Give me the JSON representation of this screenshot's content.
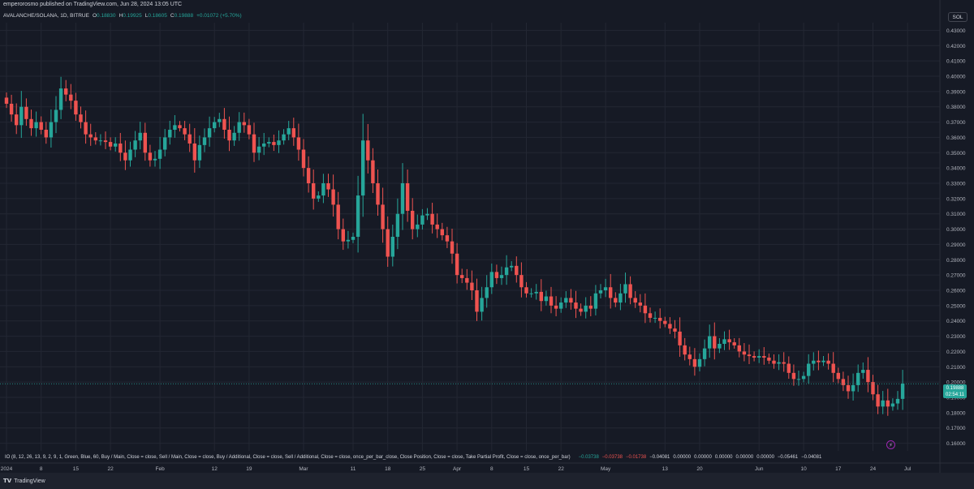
{
  "header": {
    "publisher_line": "emperorosmo published on TradingView.com, Jun 28, 2024 13:05 UTC"
  },
  "symbol": {
    "name": "AVALANCHE/SOLANA, 1D, BITRUE",
    "o_label": "O",
    "o_value": "0.18830",
    "h_label": "H",
    "h_value": "0.19925",
    "l_label": "L",
    "l_value": "0.18605",
    "c_label": "C",
    "c_value": "0.19888",
    "change": "+0.01072 (+5.70%)"
  },
  "currency_button": "SOL",
  "price_tag": {
    "price": "0.19888",
    "countdown": "02:54:11"
  },
  "colors": {
    "up": "#26a69a",
    "down": "#ef5350",
    "bg": "#161a25",
    "grid": "#232733"
  },
  "indicator": {
    "label": "IO (8, 12, 26, 13, 9, 2, 9, 1, Green, Blue, 60, Buy / Main, Close = close, Sell / Main, Close = close, Buy / Additional, Close = close, Sell / Additional, Close = close, once_per_bar_close, Close Position, Close = close, Take Partial Profit, Close = close, once_per_bar)",
    "values": [
      "−0.03738",
      "−0.03738",
      "−0.01738",
      "−0.04081",
      "0.00000",
      "0.00000",
      "0.00000",
      "0.00000",
      "0.00000",
      "−0.05461",
      "−0.04081"
    ]
  },
  "footer": {
    "brand": "TradingView"
  },
  "icons": {
    "alert": "bolt-icon",
    "logo": "tradingview-logo-icon"
  },
  "chart_data": {
    "type": "candlestick",
    "y_ticks": [
      "0.43000",
      "0.42000",
      "0.41000",
      "0.40000",
      "0.39000",
      "0.38000",
      "0.37000",
      "0.36000",
      "0.35000",
      "0.34000",
      "0.33000",
      "0.32000",
      "0.31000",
      "0.30000",
      "0.29000",
      "0.28000",
      "0.27000",
      "0.26000",
      "0.25000",
      "0.24000",
      "0.23000",
      "0.22000",
      "0.21000",
      "0.20000",
      "0.19000",
      "0.18000",
      "0.17000",
      "0.16000"
    ],
    "ylim": [
      0.155,
      0.435
    ],
    "x_ticks": [
      {
        "label": "2024",
        "day": 0
      },
      {
        "label": "8",
        "day": 7
      },
      {
        "label": "15",
        "day": 14
      },
      {
        "label": "22",
        "day": 21
      },
      {
        "label": "Feb",
        "day": 31
      },
      {
        "label": "12",
        "day": 42
      },
      {
        "label": "19",
        "day": 49
      },
      {
        "label": "Mar",
        "day": 60
      },
      {
        "label": "11",
        "day": 70
      },
      {
        "label": "18",
        "day": 77
      },
      {
        "label": "25",
        "day": 84
      },
      {
        "label": "Apr",
        "day": 91
      },
      {
        "label": "8",
        "day": 98
      },
      {
        "label": "15",
        "day": 105
      },
      {
        "label": "22",
        "day": 112
      },
      {
        "label": "May",
        "day": 121
      },
      {
        "label": "13",
        "day": 133
      },
      {
        "label": "20",
        "day": 140
      },
      {
        "label": "Jun",
        "day": 152
      },
      {
        "label": "10",
        "day": 161
      },
      {
        "label": "17",
        "day": 168
      },
      {
        "label": "24",
        "day": 175
      },
      {
        "label": "Jul",
        "day": 182
      }
    ],
    "closes": [
      0.382,
      0.375,
      0.368,
      0.38,
      0.372,
      0.366,
      0.37,
      0.365,
      0.36,
      0.37,
      0.378,
      0.392,
      0.388,
      0.384,
      0.375,
      0.37,
      0.362,
      0.36,
      0.358,
      0.358,
      0.357,
      0.354,
      0.356,
      0.35,
      0.345,
      0.352,
      0.358,
      0.363,
      0.35,
      0.345,
      0.346,
      0.352,
      0.36,
      0.365,
      0.368,
      0.366,
      0.362,
      0.356,
      0.345,
      0.355,
      0.36,
      0.366,
      0.37,
      0.372,
      0.365,
      0.358,
      0.363,
      0.37,
      0.368,
      0.362,
      0.35,
      0.354,
      0.356,
      0.357,
      0.355,
      0.358,
      0.362,
      0.366,
      0.36,
      0.352,
      0.34,
      0.33,
      0.32,
      0.322,
      0.33,
      0.326,
      0.316,
      0.3,
      0.292,
      0.293,
      0.295,
      0.322,
      0.358,
      0.345,
      0.33,
      0.316,
      0.3,
      0.282,
      0.295,
      0.31,
      0.33,
      0.312,
      0.3,
      0.303,
      0.309,
      0.31,
      0.303,
      0.3,
      0.296,
      0.292,
      0.284,
      0.27,
      0.268,
      0.265,
      0.26,
      0.246,
      0.255,
      0.262,
      0.272,
      0.268,
      0.27,
      0.275,
      0.276,
      0.27,
      0.262,
      0.258,
      0.258,
      0.259,
      0.253,
      0.256,
      0.25,
      0.248,
      0.252,
      0.255,
      0.252,
      0.248,
      0.246,
      0.25,
      0.248,
      0.258,
      0.26,
      0.262,
      0.255,
      0.252,
      0.258,
      0.264,
      0.255,
      0.252,
      0.25,
      0.245,
      0.242,
      0.242,
      0.24,
      0.238,
      0.235,
      0.233,
      0.224,
      0.218,
      0.215,
      0.21,
      0.215,
      0.222,
      0.23,
      0.222,
      0.225,
      0.228,
      0.226,
      0.224,
      0.22,
      0.218,
      0.217,
      0.216,
      0.217,
      0.216,
      0.214,
      0.212,
      0.213,
      0.212,
      0.206,
      0.202,
      0.202,
      0.204,
      0.212,
      0.214,
      0.213,
      0.214,
      0.212,
      0.206,
      0.202,
      0.198,
      0.194,
      0.198,
      0.206,
      0.208,
      0.2,
      0.192,
      0.184,
      0.188,
      0.184,
      0.186,
      0.189,
      0.199
    ]
  }
}
